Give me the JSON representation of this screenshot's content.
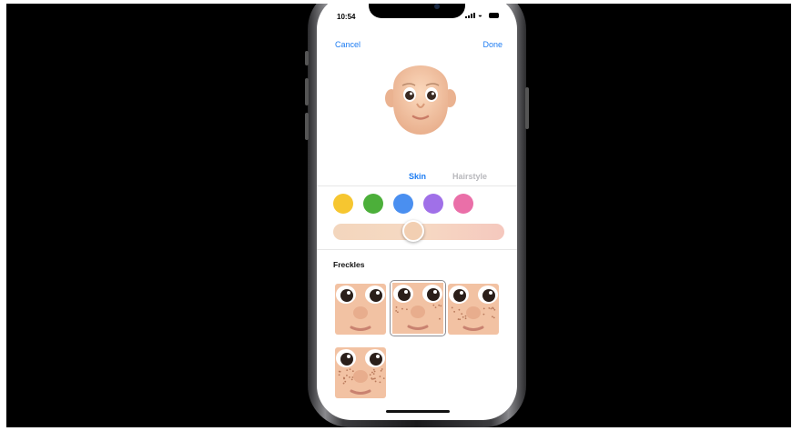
{
  "status_bar": {
    "time": "10:54"
  },
  "nav": {
    "cancel_label": "Cancel",
    "done_label": "Done"
  },
  "tabs": [
    {
      "label": "Skin",
      "selected": true
    },
    {
      "label": "Hairstyle",
      "selected": false
    }
  ],
  "skin_color_swatches": [
    "#f6c630",
    "#4caf3a",
    "#4a8ff0",
    "#a070e8",
    "#ea6fa8"
  ],
  "skin_tone_slider": {
    "value": 0.47
  },
  "freckles": {
    "label": "Freckles",
    "options": [
      {
        "name": "freckles-none",
        "selected": false
      },
      {
        "name": "freckles-light",
        "selected": true
      },
      {
        "name": "freckles-medium",
        "selected": false
      },
      {
        "name": "freckles-heavy",
        "selected": false
      }
    ]
  },
  "colors": {
    "accent": "#1d7cf2"
  }
}
